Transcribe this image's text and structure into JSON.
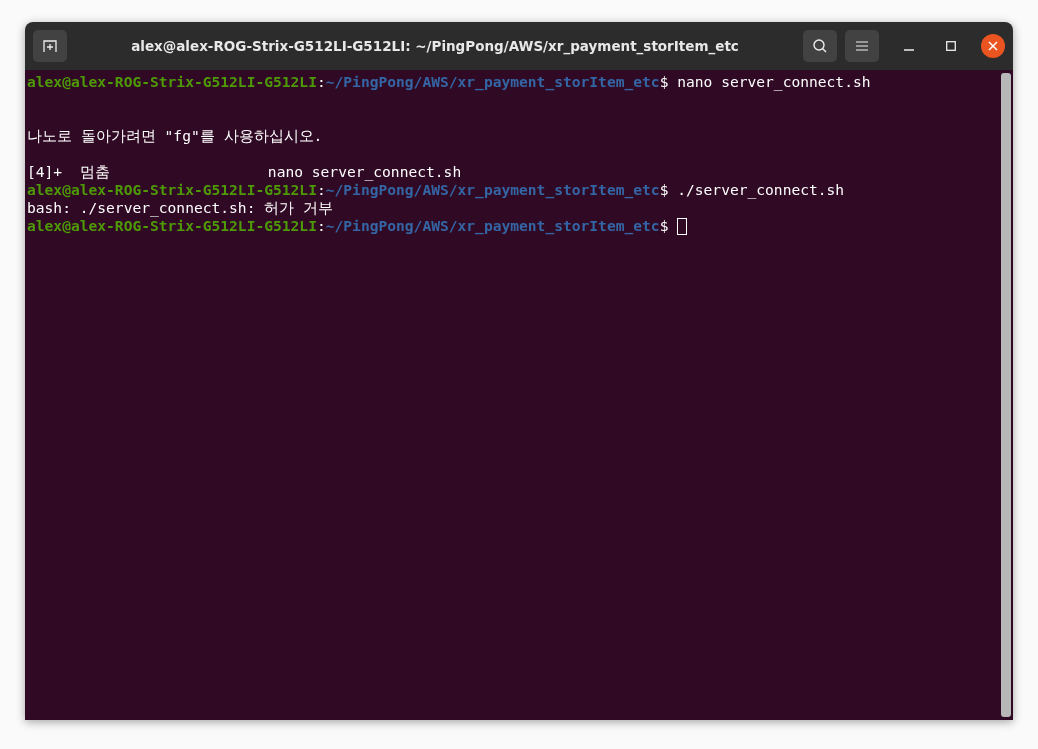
{
  "window": {
    "title": "alex@alex-ROG-Strix-G512LI-G512LI: ~/PingPong/AWS/xr_payment_storItem_etc"
  },
  "terminal": {
    "lines": [
      {
        "kind": "prompt",
        "user_host": "alex@alex-ROG-Strix-G512LI-G512LI",
        "separator": ":",
        "path": "~/PingPong/AWS/xr_payment_storItem_etc",
        "command": "$ nano server_connect.sh",
        "cursor": false
      },
      {
        "kind": "blank"
      },
      {
        "kind": "blank"
      },
      {
        "kind": "output",
        "text": "나노로 돌아가려면 \"fg\"를 사용하십시오."
      },
      {
        "kind": "blank"
      },
      {
        "kind": "output",
        "text": "[4]+  멈춤                  nano server_connect.sh"
      },
      {
        "kind": "prompt",
        "user_host": "alex@alex-ROG-Strix-G512LI-G512LI",
        "separator": ":",
        "path": "~/PingPong/AWS/xr_payment_storItem_etc",
        "command": "$ ./server_connect.sh",
        "cursor": false
      },
      {
        "kind": "output",
        "text": "bash: ./server_connect.sh: 허가 거부"
      },
      {
        "kind": "prompt",
        "user_host": "alex@alex-ROG-Strix-G512LI-G512LI",
        "separator": ":",
        "path": "~/PingPong/AWS/xr_payment_storItem_etc",
        "command": "$",
        "cursor": true
      }
    ]
  }
}
